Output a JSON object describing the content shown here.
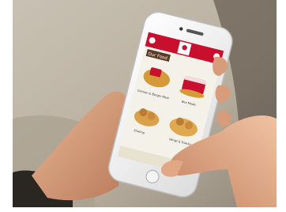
{
  "app": {
    "section_title": "Our Food",
    "items": [
      {
        "label": "Chicken & Burger Meal"
      },
      {
        "label": "Box Meals"
      },
      {
        "label": "Sharing"
      },
      {
        "label": "Wings & Snacks"
      }
    ],
    "colors": {
      "brand_red": "#c8102e",
      "screen_bg": "#f4f1e8",
      "item_gold": "#d49a3a"
    },
    "icons": [
      "kfc-logo-icon",
      "back-icon",
      "close-icon"
    ]
  }
}
